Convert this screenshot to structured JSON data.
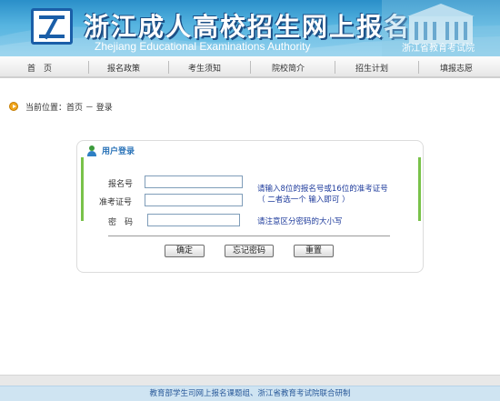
{
  "header": {
    "title": "浙江成人高校招生网上报名",
    "subtitle": "Zhejiang Educational Examinations Authority",
    "org_name": "浙江省教育考试院"
  },
  "nav": {
    "items": [
      {
        "label": "首　页"
      },
      {
        "label": "报名政策"
      },
      {
        "label": "考生须知"
      },
      {
        "label": "院校简介"
      },
      {
        "label": "招生计划"
      },
      {
        "label": "填报志愿"
      }
    ]
  },
  "breadcrumb": {
    "text": "当前位置：首页 － 登录"
  },
  "login": {
    "title": "用户登录",
    "fields": {
      "reg_no": {
        "label": "报名号",
        "value": ""
      },
      "admission_no": {
        "label": "准考证号",
        "value": ""
      },
      "password": {
        "label": "密　码",
        "value": ""
      }
    },
    "hints": {
      "line1": "请输入8位的报名号或16位的准考证号",
      "line2": "（ 二者选一个  输入即可 ）",
      "password": "请注意区分密码的大小写"
    },
    "buttons": {
      "confirm": "确定",
      "forgot": "忘记密码",
      "reset": "重置"
    }
  },
  "footer": {
    "text": "教育部学生司网上报名课题组、浙江省教育考试院联合研制"
  },
  "colors": {
    "banner": "#2a8fc9",
    "panel_title": "#2a73b8",
    "hint": "#1f3c9c",
    "accent_green": "#79c24a",
    "footer_bar": "#cfe4f2"
  }
}
